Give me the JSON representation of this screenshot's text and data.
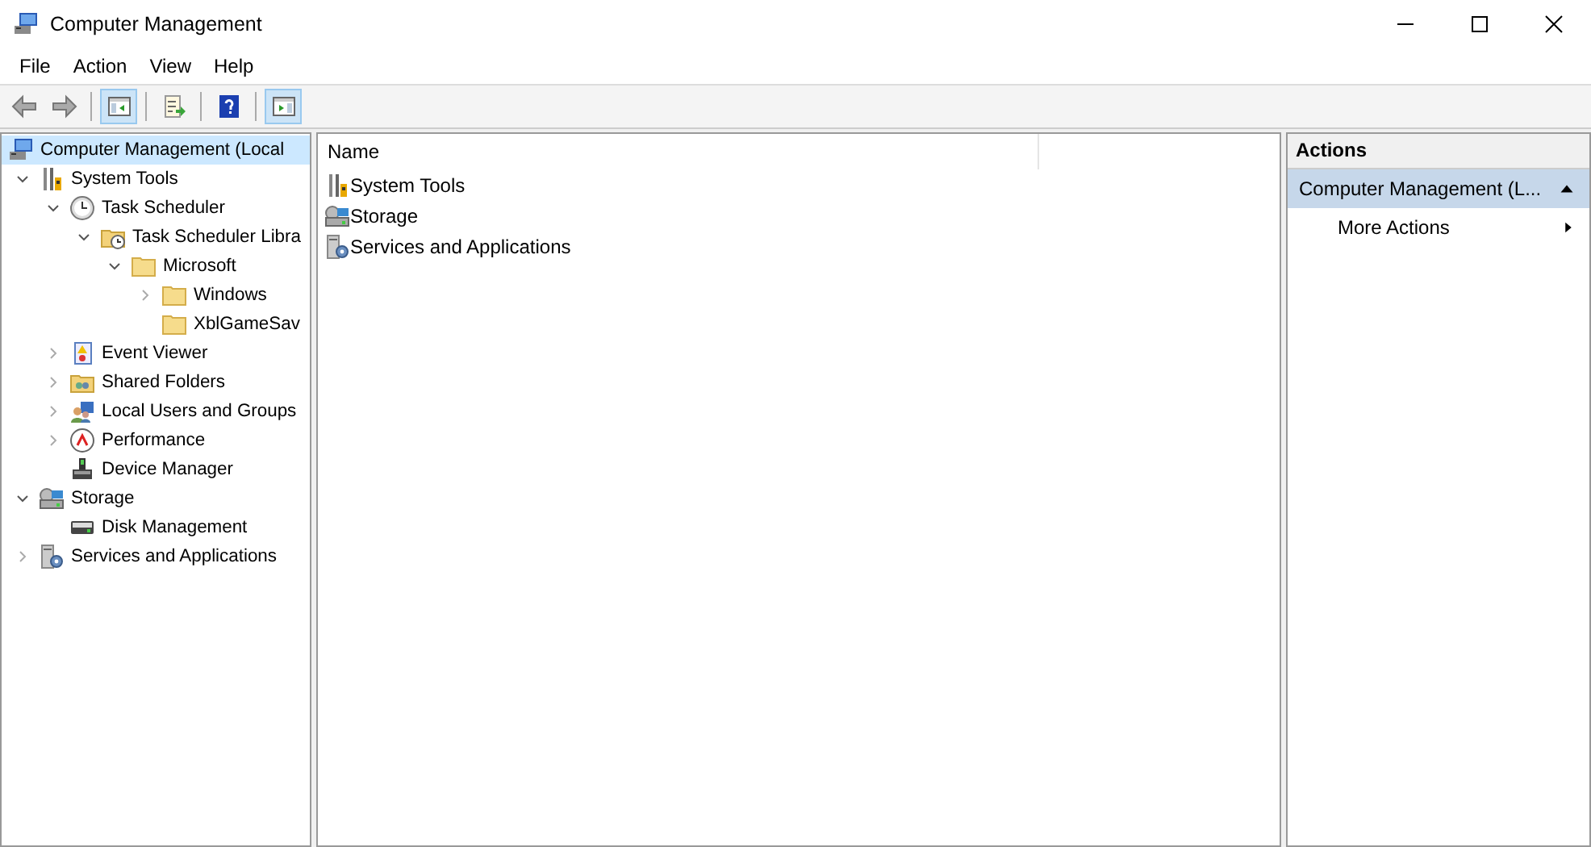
{
  "window": {
    "title": "Computer Management"
  },
  "menu": [
    "File",
    "Action",
    "View",
    "Help"
  ],
  "toolbar": [
    {
      "kind": "back",
      "on": false
    },
    {
      "kind": "forward",
      "on": false
    },
    {
      "kind": "tree",
      "on": true
    },
    {
      "kind": "export",
      "on": false
    },
    {
      "kind": "help",
      "on": false
    },
    {
      "kind": "actionpane",
      "on": true
    }
  ],
  "tree": [
    {
      "label": "Computer Management (Local",
      "kind": "computer",
      "selected": true,
      "children": [
        {
          "label": "System Tools",
          "kind": "tools",
          "selected": false,
          "expanded": true,
          "children": [
            {
              "label": "Task Scheduler",
              "kind": "clock",
              "selected": false,
              "expanded": true,
              "children": [
                {
                  "label": "Task Scheduler Libra",
                  "kind": "clockfolder",
                  "selected": false,
                  "expanded": true,
                  "children": [
                    {
                      "label": "Microsoft",
                      "kind": "folder",
                      "selected": false,
                      "expanded": true,
                      "children": [
                        {
                          "label": "Windows",
                          "kind": "folder",
                          "selected": false,
                          "expanded": false
                        },
                        {
                          "label": "XblGameSav",
                          "kind": "folder",
                          "selected": false
                        }
                      ]
                    }
                  ]
                }
              ]
            },
            {
              "label": "Event Viewer",
              "kind": "log",
              "selected": false,
              "expanded": false
            },
            {
              "label": "Shared Folders",
              "kind": "shared",
              "selected": false,
              "expanded": false
            },
            {
              "label": "Local Users and Groups",
              "kind": "users",
              "selected": false,
              "expanded": false
            },
            {
              "label": "Performance",
              "kind": "gauge",
              "selected": false,
              "expanded": false
            },
            {
              "label": "Device Manager",
              "kind": "device",
              "selected": false
            }
          ]
        },
        {
          "label": "Storage",
          "kind": "storage",
          "selected": false,
          "expanded": true,
          "children": [
            {
              "label": "Disk Management",
              "kind": "disk",
              "selected": false
            }
          ]
        },
        {
          "label": "Services and Applications",
          "kind": "services",
          "selected": false,
          "expanded": false
        }
      ]
    }
  ],
  "list": {
    "columns": [
      "Name"
    ],
    "rows": [
      {
        "name": "System Tools",
        "kind": "tools"
      },
      {
        "name": "Storage",
        "kind": "storage"
      },
      {
        "name": "Services and Applications",
        "kind": "services"
      }
    ]
  },
  "actions": {
    "title": "Actions",
    "groups": [
      {
        "label": "Computer Management (L...",
        "expanded": true,
        "items": [
          {
            "label": "More Actions",
            "submenu": true
          }
        ]
      }
    ]
  }
}
